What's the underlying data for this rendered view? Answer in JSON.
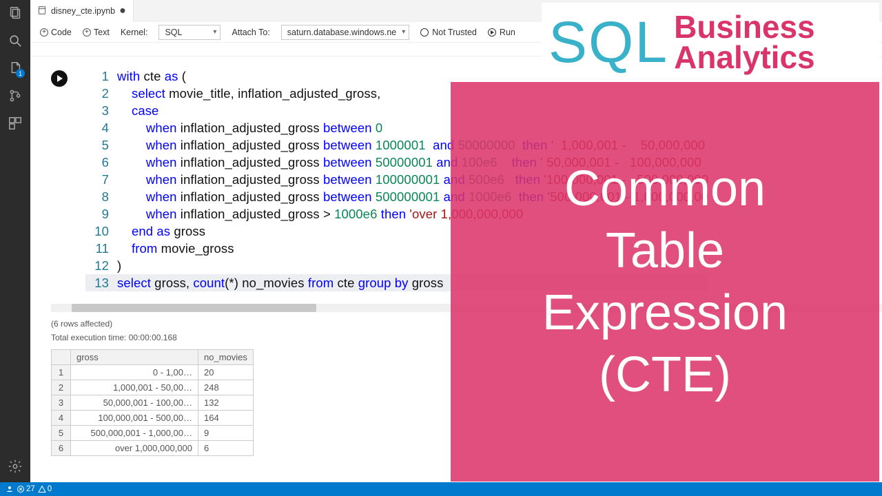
{
  "tab": {
    "filename": "disney_cte.ipynb",
    "dirty": true
  },
  "toolbar": {
    "code": "Code",
    "text": "Text",
    "kernel_label": "Kernel:",
    "kernel": "SQL",
    "attach_label": "Attach To:",
    "attach": "saturn.database.windows.ne",
    "trust": "Not Trusted",
    "run": "Run"
  },
  "code_lines": [
    {
      "n": 1,
      "indent": 0,
      "tokens": [
        [
          "kw",
          "with"
        ],
        [
          "id",
          " cte "
        ],
        [
          "kw",
          "as"
        ],
        [
          "id",
          " ("
        ]
      ]
    },
    {
      "n": 2,
      "indent": 1,
      "tokens": [
        [
          "kw",
          "select"
        ],
        [
          "id",
          " movie_title, inflation_adjusted_gross,"
        ]
      ]
    },
    {
      "n": 3,
      "indent": 1,
      "tokens": [
        [
          "kw",
          "case"
        ]
      ]
    },
    {
      "n": 4,
      "indent": 2,
      "tokens": [
        [
          "kw",
          "when"
        ],
        [
          "id",
          " inflation_adjusted_gross "
        ],
        [
          "kw",
          "between"
        ],
        [
          "id",
          " "
        ],
        [
          "num",
          "0"
        ]
      ]
    },
    {
      "n": 5,
      "indent": 2,
      "tokens": [
        [
          "kw",
          "when"
        ],
        [
          "id",
          " inflation_adjusted_gross "
        ],
        [
          "kw",
          "between"
        ],
        [
          "id",
          " "
        ],
        [
          "num",
          "1000001"
        ],
        [
          "id",
          "  "
        ],
        [
          "kw",
          "and"
        ],
        [
          "id",
          " "
        ],
        [
          "num",
          "50000000"
        ],
        [
          "id",
          "  "
        ],
        [
          "kw",
          "then"
        ],
        [
          "id",
          " "
        ],
        [
          "str",
          "'  1,000,001 -    50,000,000"
        ]
      ]
    },
    {
      "n": 6,
      "indent": 2,
      "tokens": [
        [
          "kw",
          "when"
        ],
        [
          "id",
          " inflation_adjusted_gross "
        ],
        [
          "kw",
          "between"
        ],
        [
          "id",
          " "
        ],
        [
          "num",
          "50000001"
        ],
        [
          "id",
          " "
        ],
        [
          "kw",
          "and"
        ],
        [
          "id",
          " "
        ],
        [
          "num",
          "100e6"
        ],
        [
          "id",
          "    "
        ],
        [
          "kw",
          "then"
        ],
        [
          "id",
          " "
        ],
        [
          "str",
          "' 50,000,001 -   100,000,000"
        ]
      ]
    },
    {
      "n": 7,
      "indent": 2,
      "tokens": [
        [
          "kw",
          "when"
        ],
        [
          "id",
          " inflation_adjusted_gross "
        ],
        [
          "kw",
          "between"
        ],
        [
          "id",
          " "
        ],
        [
          "num",
          "100000001"
        ],
        [
          "id",
          " "
        ],
        [
          "kw",
          "and"
        ],
        [
          "id",
          " "
        ],
        [
          "num",
          "500e6"
        ],
        [
          "id",
          "   "
        ],
        [
          "kw",
          "then"
        ],
        [
          "id",
          " "
        ],
        [
          "str",
          "'100,000,001 -   500,000,000"
        ]
      ]
    },
    {
      "n": 8,
      "indent": 2,
      "tokens": [
        [
          "kw",
          "when"
        ],
        [
          "id",
          " inflation_adjusted_gross "
        ],
        [
          "kw",
          "between"
        ],
        [
          "id",
          " "
        ],
        [
          "num",
          "500000001"
        ],
        [
          "id",
          " "
        ],
        [
          "kw",
          "and"
        ],
        [
          "id",
          " "
        ],
        [
          "num",
          "1000e6"
        ],
        [
          "id",
          "  "
        ],
        [
          "kw",
          "then"
        ],
        [
          "id",
          " "
        ],
        [
          "str",
          "'500,000,001 - 1,000,000,00"
        ]
      ]
    },
    {
      "n": 9,
      "indent": 2,
      "tokens": [
        [
          "kw",
          "when"
        ],
        [
          "id",
          " inflation_adjusted_gross > "
        ],
        [
          "num",
          "1000e6"
        ],
        [
          "id",
          " "
        ],
        [
          "kw",
          "then"
        ],
        [
          "id",
          " "
        ],
        [
          "str",
          "'over 1,000,000,000"
        ]
      ]
    },
    {
      "n": 10,
      "indent": 1,
      "tokens": [
        [
          "kw",
          "end"
        ],
        [
          "id",
          " "
        ],
        [
          "kw",
          "as"
        ],
        [
          "id",
          " gross"
        ]
      ]
    },
    {
      "n": 11,
      "indent": 1,
      "tokens": [
        [
          "kw",
          "from"
        ],
        [
          "id",
          " movie_gross"
        ]
      ]
    },
    {
      "n": 12,
      "indent": 0,
      "tokens": [
        [
          "id",
          ")"
        ]
      ]
    },
    {
      "n": 13,
      "indent": 0,
      "tokens": [
        [
          "kw",
          "select"
        ],
        [
          "id",
          " gross, "
        ],
        [
          "kw",
          "count"
        ],
        [
          "id",
          "(*) no_movies "
        ],
        [
          "kw",
          "from"
        ],
        [
          "id",
          " cte "
        ],
        [
          "kw",
          "group by"
        ],
        [
          "id",
          " gross"
        ]
      ]
    }
  ],
  "output": {
    "rows_affected": "(6 rows affected)",
    "exec_time": "Total execution time: 00:00:00.168",
    "headers": [
      "",
      "gross",
      "no_movies"
    ],
    "rows": [
      {
        "idx": "1",
        "gross": "0 -     1,00…",
        "no_movies": "20"
      },
      {
        "idx": "2",
        "gross": "1,000,001 -    50,00…",
        "no_movies": "248"
      },
      {
        "idx": "3",
        "gross": "50,000,001 -   100,00…",
        "no_movies": "132"
      },
      {
        "idx": "4",
        "gross": "100,000,001 -   500,00…",
        "no_movies": "164"
      },
      {
        "idx": "5",
        "gross": "500,000,001 - 1,000,00…",
        "no_movies": "9"
      },
      {
        "idx": "6",
        "gross": "over 1,000,000,000",
        "no_movies": "6"
      }
    ]
  },
  "status": {
    "errors": "27",
    "warnings": "0"
  },
  "brand": {
    "sql": "SQL",
    "biz1": "Business",
    "biz2": "Analytics",
    "title": "Common\nTable\nExpression\n(CTE)"
  },
  "activity_badge": "1"
}
